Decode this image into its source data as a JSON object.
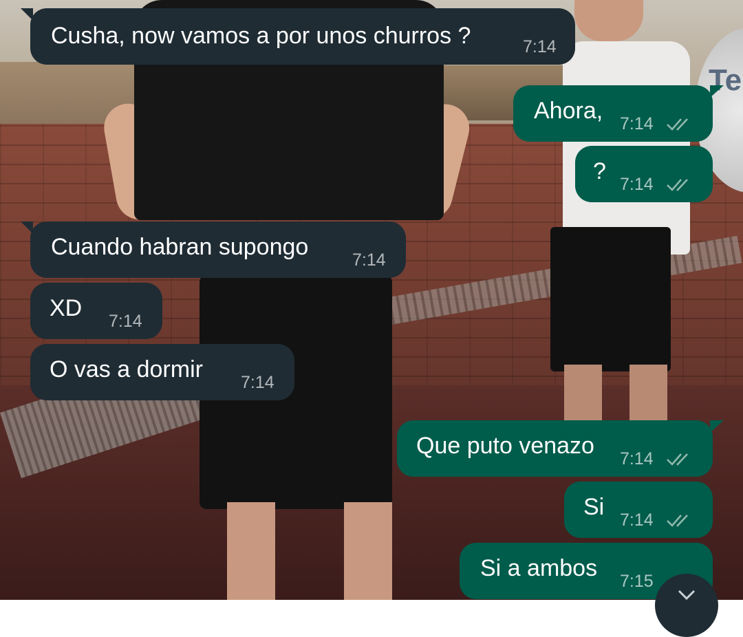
{
  "messages": [
    {
      "direction": "incoming",
      "text": "Cusha, now vamos a por unos churros ?",
      "time": "7:14"
    },
    {
      "direction": "outgoing",
      "text": "Ahora,",
      "time": "7:14",
      "status": "read",
      "status_icon": "double-check-icon"
    },
    {
      "direction": "outgoing",
      "text": "?",
      "time": "7:14",
      "status": "read",
      "status_icon": "double-check-icon"
    },
    {
      "direction": "incoming",
      "text": "Cuando habran supongo",
      "time": "7:14"
    },
    {
      "direction": "incoming",
      "text": "XD",
      "time": "7:14"
    },
    {
      "direction": "incoming",
      "text": "O vas a dormir",
      "time": "7:14"
    },
    {
      "direction": "outgoing",
      "text": "Que puto venazo",
      "time": "7:14",
      "status": "read",
      "status_icon": "double-check-icon"
    },
    {
      "direction": "outgoing",
      "text": "Si",
      "time": "7:14",
      "status": "read",
      "status_icon": "double-check-icon"
    },
    {
      "direction": "outgoing",
      "text": "Si a ambos",
      "time": "7:15",
      "status": "read",
      "status_icon": "double-check-icon"
    }
  ],
  "scroll_button": {
    "icon": "chevron-down-icon"
  },
  "colors": {
    "incoming_bubble": "#1f2c34",
    "outgoing_bubble": "#005c4b",
    "read_ticks": "#8fb8ad",
    "time_text": "#c9d1d4"
  }
}
